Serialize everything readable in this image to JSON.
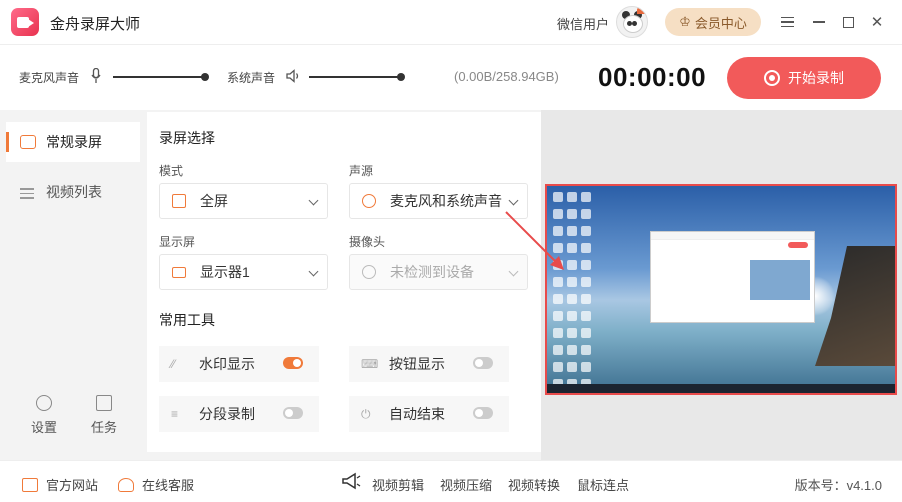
{
  "app": {
    "title": "金舟录屏大师"
  },
  "header": {
    "user_name": "微信用户",
    "vip_label": "会员中心",
    "vip_icon": "crown-icon"
  },
  "audio": {
    "mic_label": "麦克风声音",
    "mic_level": 1.0,
    "system_label": "系统声音",
    "system_level": 1.0,
    "storage": "(0.00B/258.94GB)",
    "timer": "00:00:00",
    "record_label": "开始录制"
  },
  "sidebar": {
    "items": [
      {
        "label": "常规录屏",
        "active": true
      },
      {
        "label": "视频列表",
        "active": false
      }
    ],
    "settings_label": "设置",
    "tasks_label": "任务"
  },
  "panel": {
    "section_title": "录屏选择",
    "mode_label": "模式",
    "mode_value": "全屏",
    "audio_label": "声源",
    "audio_value": "麦克风和系统声音",
    "display_label": "显示屏",
    "display_value": "显示器1",
    "camera_label": "摄像头",
    "camera_value": "未检测到设备",
    "tools_title": "常用工具",
    "tools": [
      {
        "label": "水印显示",
        "on": true
      },
      {
        "label": "按钮显示",
        "on": false
      },
      {
        "label": "分段录制",
        "on": false
      },
      {
        "label": "自动结束",
        "on": false
      }
    ]
  },
  "footer": {
    "website": "官方网站",
    "support": "在线客服",
    "links": [
      "视频剪辑",
      "视频压缩",
      "视频转换",
      "鼠标连点"
    ],
    "version": "版本号：v4.1.0"
  },
  "colors": {
    "accent": "#f07a3a",
    "record": "#f25a5a",
    "vip_bg": "#f6dfc4",
    "preview_border": "#e84b4b"
  }
}
